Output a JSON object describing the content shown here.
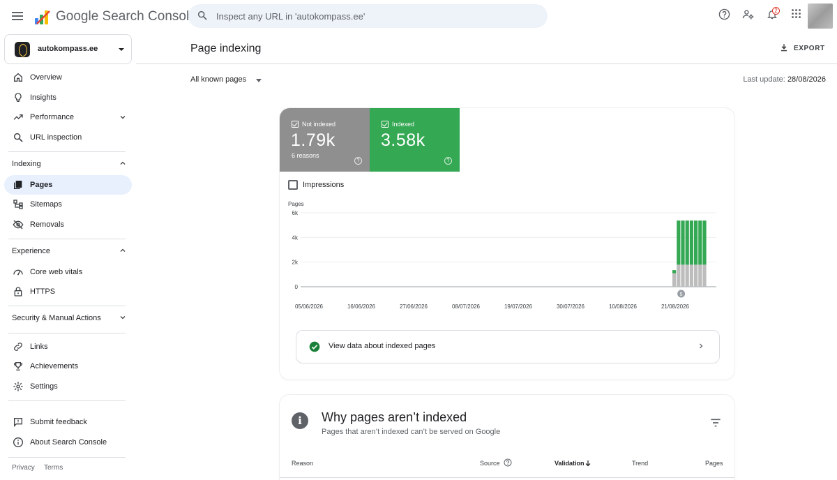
{
  "app": {
    "title": "Google Search Console",
    "search_placeholder": "Inspect any URL in 'autokompass.ee'",
    "notification_count": "2"
  },
  "property": {
    "name": "autokompass.ee"
  },
  "sidebar": {
    "top_items": [
      {
        "label": "Overview",
        "icon": "home-icon"
      },
      {
        "label": "Insights",
        "icon": "lightbulb-icon"
      },
      {
        "label": "Performance",
        "icon": "trending-up-icon"
      },
      {
        "label": "URL inspection",
        "icon": "search-icon"
      }
    ],
    "indexing": {
      "label": "Indexing",
      "items": [
        {
          "label": "Pages",
          "icon": "pages-icon",
          "active": true
        },
        {
          "label": "Sitemaps",
          "icon": "sitemap-icon"
        },
        {
          "label": "Removals",
          "icon": "visibility-off-icon"
        }
      ]
    },
    "experience": {
      "label": "Experience",
      "items": [
        {
          "label": "Core web vitals",
          "icon": "speed-icon"
        },
        {
          "label": "HTTPS",
          "icon": "lock-icon"
        }
      ]
    },
    "security": {
      "label": "Security & Manual Actions"
    },
    "bottom_items": [
      {
        "label": "Links",
        "icon": "link-icon"
      },
      {
        "label": "Achievements",
        "icon": "trophy-icon"
      },
      {
        "label": "Settings",
        "icon": "settings-icon"
      }
    ],
    "feedback_items": [
      {
        "label": "Submit feedback",
        "icon": "feedback-icon"
      },
      {
        "label": "About Search Console",
        "icon": "info-icon"
      }
    ],
    "footer": {
      "privacy": "Privacy",
      "terms": "Terms"
    }
  },
  "header": {
    "title": "Page indexing",
    "export_label": "EXPORT",
    "filter_value": "All known pages",
    "last_update_label": "Last update:",
    "last_update_value": "28/08/2026"
  },
  "summary": {
    "not_indexed": {
      "label": "Not indexed",
      "value": "1.79k",
      "sub": "6 reasons",
      "color": "#8f8f8f"
    },
    "indexed": {
      "label": "Indexed",
      "value": "3.58k",
      "color": "#34a853"
    },
    "impressions_label": "Impressions"
  },
  "chart_data": {
    "type": "bar",
    "stacked": true,
    "ylabel": "Pages",
    "ylim": [
      0,
      6000
    ],
    "yticks": [
      "0",
      "2k",
      "4k",
      "6k"
    ],
    "xtick_labels": [
      "05/06/2026",
      "16/06/2026",
      "27/06/2026",
      "08/07/2026",
      "19/07/2026",
      "30/07/2026",
      "10/08/2026",
      "21/08/2026"
    ],
    "annotation": "5",
    "categories": [
      "21/08/2026",
      "22/08/2026",
      "23/08/2026",
      "24/08/2026",
      "25/08/2026",
      "26/08/2026",
      "27/08/2026",
      "28/08/2026"
    ],
    "series": [
      {
        "name": "Not indexed",
        "color": "#bdbdbd",
        "values": [
          1100,
          1790,
          1790,
          1790,
          1790,
          1790,
          1790,
          1790
        ]
      },
      {
        "name": "Indexed",
        "color": "#34a853",
        "values": [
          250,
          3580,
          3580,
          3580,
          3580,
          3580,
          3580,
          3580
        ]
      }
    ]
  },
  "indexed_link": {
    "label": "View data about indexed pages"
  },
  "why_section": {
    "title": "Why pages aren’t indexed",
    "subtitle": "Pages that aren’t indexed can’t be served on Google",
    "columns": {
      "reason": "Reason",
      "source": "Source",
      "validation": "Validation",
      "trend": "Trend",
      "pages": "Pages"
    }
  }
}
